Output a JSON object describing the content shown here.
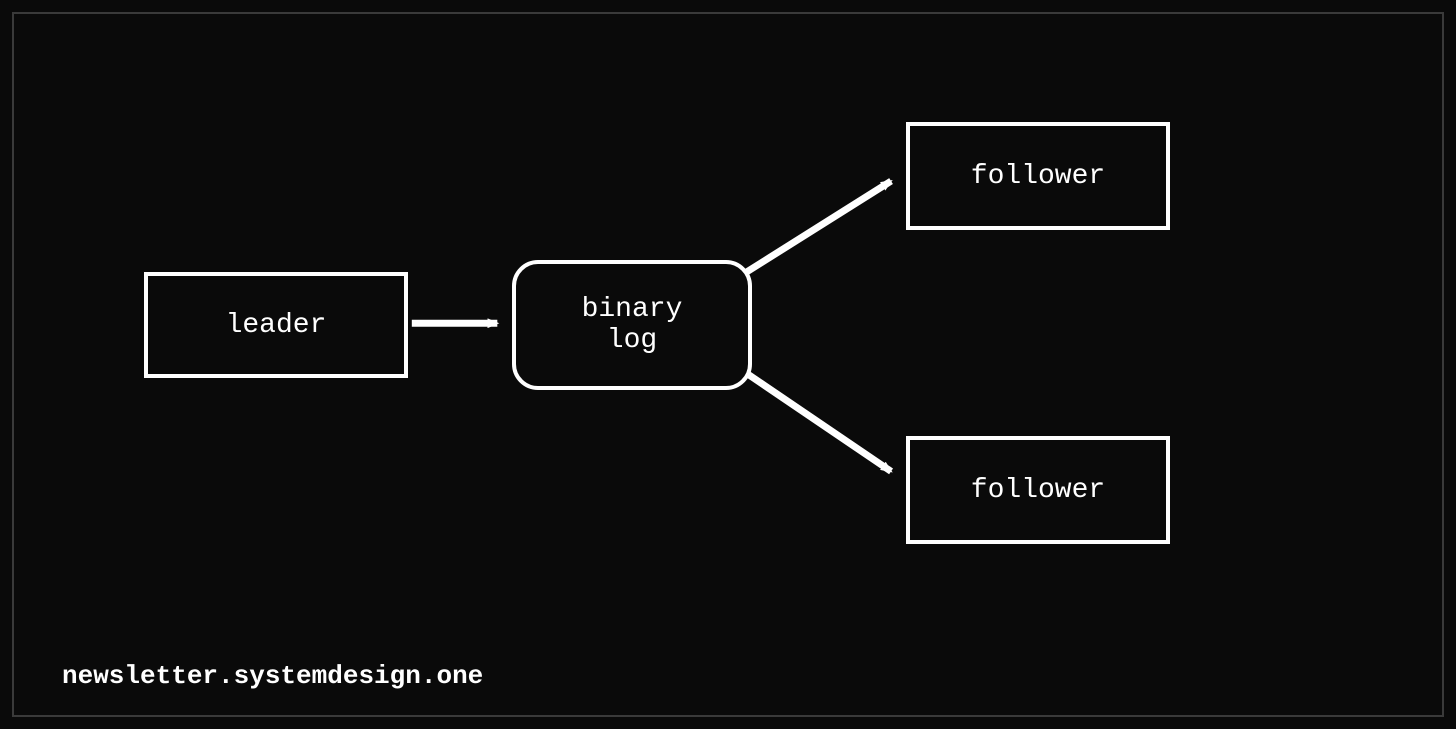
{
  "diagram": {
    "nodes": {
      "leader": {
        "label": "leader",
        "shape": "rect"
      },
      "binlog": {
        "label": "binary\nlog",
        "shape": "rounded"
      },
      "follower_top": {
        "label": "follower",
        "shape": "rect"
      },
      "follower_bottom": {
        "label": "follower",
        "shape": "rect"
      }
    },
    "edges": [
      {
        "from": "leader",
        "to": "binlog"
      },
      {
        "from": "binlog",
        "to": "follower_top"
      },
      {
        "from": "binlog",
        "to": "follower_bottom"
      }
    ]
  },
  "watermark": "newsletter.systemdesign.one",
  "colors": {
    "background": "#0a0a0a",
    "stroke": "#ffffff",
    "border": "#3a3a3a"
  }
}
